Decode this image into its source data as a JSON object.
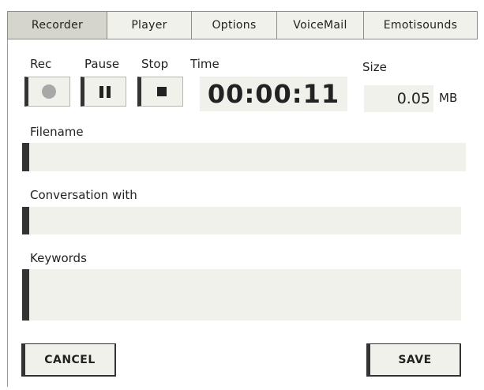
{
  "tabs": [
    {
      "label": "Recorder",
      "active": true
    },
    {
      "label": "Player",
      "active": false
    },
    {
      "label": "Options",
      "active": false
    },
    {
      "label": "VoiceMail",
      "active": false
    },
    {
      "label": "Emotisounds",
      "active": false
    }
  ],
  "controls": {
    "rec_label": "Rec",
    "pause_label": "Pause",
    "stop_label": "Stop",
    "time_label": "Time",
    "time_value": "00:00:11",
    "size_label": "Size",
    "size_value": "0.05",
    "size_unit": "MB"
  },
  "fields": {
    "filename_label": "Filename",
    "filename_value": "",
    "conversation_label": "Conversation with",
    "conversation_value": "",
    "keywords_label": "Keywords",
    "keywords_value": ""
  },
  "actions": {
    "cancel_label": "CANCEL",
    "save_label": "SAVE"
  },
  "colors": {
    "active_tab": "#d6d5cd",
    "field_bg": "#f1f1ec",
    "accent_bar": "#333333"
  }
}
